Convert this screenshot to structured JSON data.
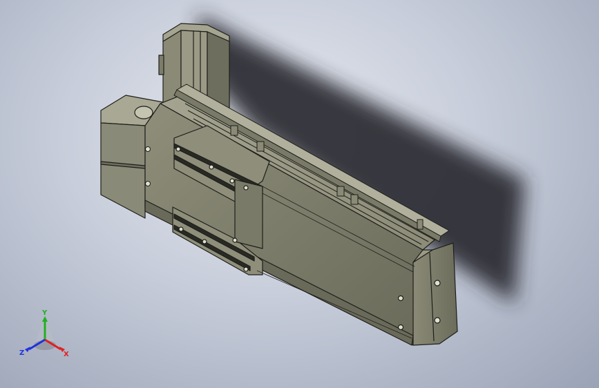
{
  "viewport": {
    "background_top": "#e6e9f0",
    "background_bottom": "#9aa3b6",
    "model_color": "#7c7c6a",
    "model_highlight": "#9c9c88",
    "model_shadow": "#55554a",
    "edge_color": "#1e1e1a",
    "drop_shadow_color": "#2a2c30"
  },
  "triad": {
    "x_label": "X",
    "y_label": "Y",
    "z_label": "Z",
    "x_color": "#e02020",
    "y_color": "#20b020",
    "z_color": "#2030e0"
  }
}
